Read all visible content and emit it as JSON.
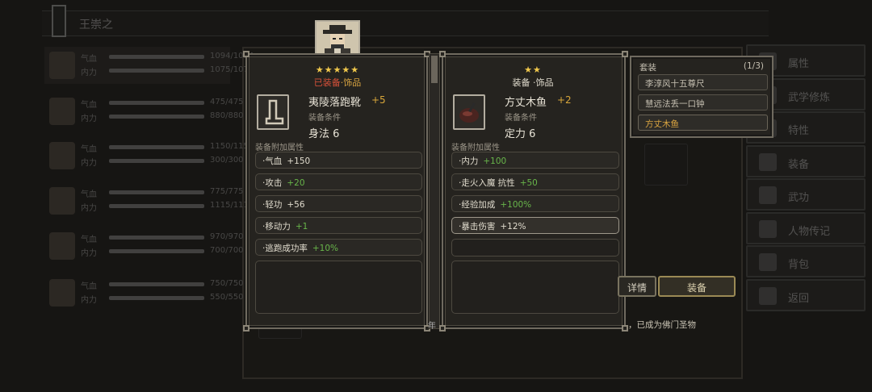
{
  "header": {
    "title": "王崇之"
  },
  "roster": [
    {
      "hp_label": "气血",
      "hp": "1094/1094",
      "mp_label": "内力",
      "mp": "1075/1075"
    },
    {
      "hp_label": "气血",
      "hp": "475/475",
      "mp_label": "内力",
      "mp": "880/880"
    },
    {
      "hp_label": "气血",
      "hp": "1150/1150",
      "mp_label": "内力",
      "mp": "300/300"
    },
    {
      "hp_label": "气血",
      "hp": "775/775",
      "mp_label": "内力",
      "mp": "1115/1115"
    },
    {
      "hp_label": "气血",
      "hp": "970/970",
      "mp_label": "内力",
      "mp": "700/700"
    },
    {
      "hp_label": "气血",
      "hp": "750/750",
      "mp_label": "内力",
      "mp": "550/550"
    }
  ],
  "side_menu": [
    "属性",
    "武学修炼",
    "特性",
    "装备",
    "武功",
    "人物传记",
    "背包",
    "返回"
  ],
  "left_item": {
    "stars": "★★★★★",
    "status": "已装备",
    "category": "·饰品",
    "name": "夷陵落跑靴",
    "plus": "+5",
    "req_label": "装备条件",
    "req_value": "身法  6",
    "section_title": "装备附加属性",
    "attrs": [
      {
        "name": "·气血",
        "value": "+150",
        "color": "white"
      },
      {
        "name": "·攻击",
        "value": "+20",
        "color": "green"
      },
      {
        "name": "·轻功",
        "value": "+56",
        "color": "white"
      },
      {
        "name": "·移动力",
        "value": "+1",
        "color": "green"
      },
      {
        "name": "·逃跑成功率",
        "value": "+10%",
        "color": "green"
      }
    ]
  },
  "right_item": {
    "stars": "★★",
    "category": "装备 ·饰品",
    "name": "方丈木鱼",
    "plus": "+2",
    "req_label": "装备条件",
    "req_value": "定力  6",
    "section_title": "装备附加属性",
    "attrs": [
      {
        "name": "·内力",
        "value": "+100",
        "color": "green"
      },
      {
        "name": "·走火入魔 抗性",
        "value": "+50",
        "color": "green"
      },
      {
        "name": "·经验加成",
        "value": "+100%",
        "color": "green"
      },
      {
        "name": "·暴击伤害",
        "value": "+12%",
        "color": "white"
      }
    ]
  },
  "set_panel": {
    "title": "套装",
    "count": "(1/3)",
    "items": [
      "李淳风十五尊尺",
      "慧远法丢一口钟",
      "方丈木鱼"
    ],
    "active_index": 2
  },
  "buttons": {
    "detail": "详情",
    "equip": "装备"
  },
  "note": "，已成为佛门圣物",
  "year_stub": "年",
  "colors": {
    "accent_gold": "#d9a441",
    "green": "#68b54a",
    "status_red": "#d9523a",
    "star": "#f2c94c"
  }
}
